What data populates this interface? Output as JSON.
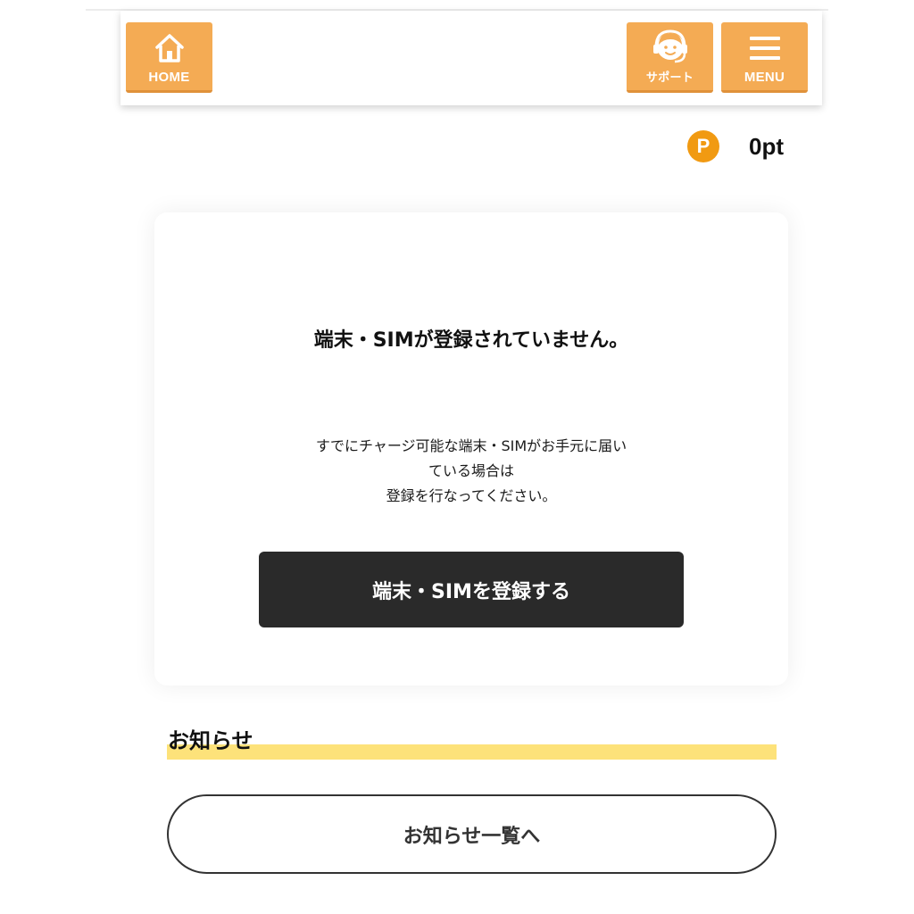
{
  "header": {
    "home_label": "HOME",
    "support_label": "サポート",
    "menu_label": "MENU",
    "accent_color": "#f4ab54"
  },
  "points": {
    "badge": "P",
    "value": "0pt",
    "badge_color": "#f19a12"
  },
  "card": {
    "title": "端末・SIMが登録されていません。",
    "description_lines": [
      "すでにチャージ可能な端末・SIMがお手元に届い",
      "ている場合は",
      "登録を行なってください。"
    ],
    "register_button_label": "端末・SIMを登録する"
  },
  "news": {
    "heading": "お知らせ",
    "list_button_label": "お知らせ一覧へ",
    "underline_color": "#fde27a"
  },
  "icons": [
    "home-icon",
    "support-headset-icon",
    "hamburger-menu-icon",
    "points-badge-icon"
  ]
}
